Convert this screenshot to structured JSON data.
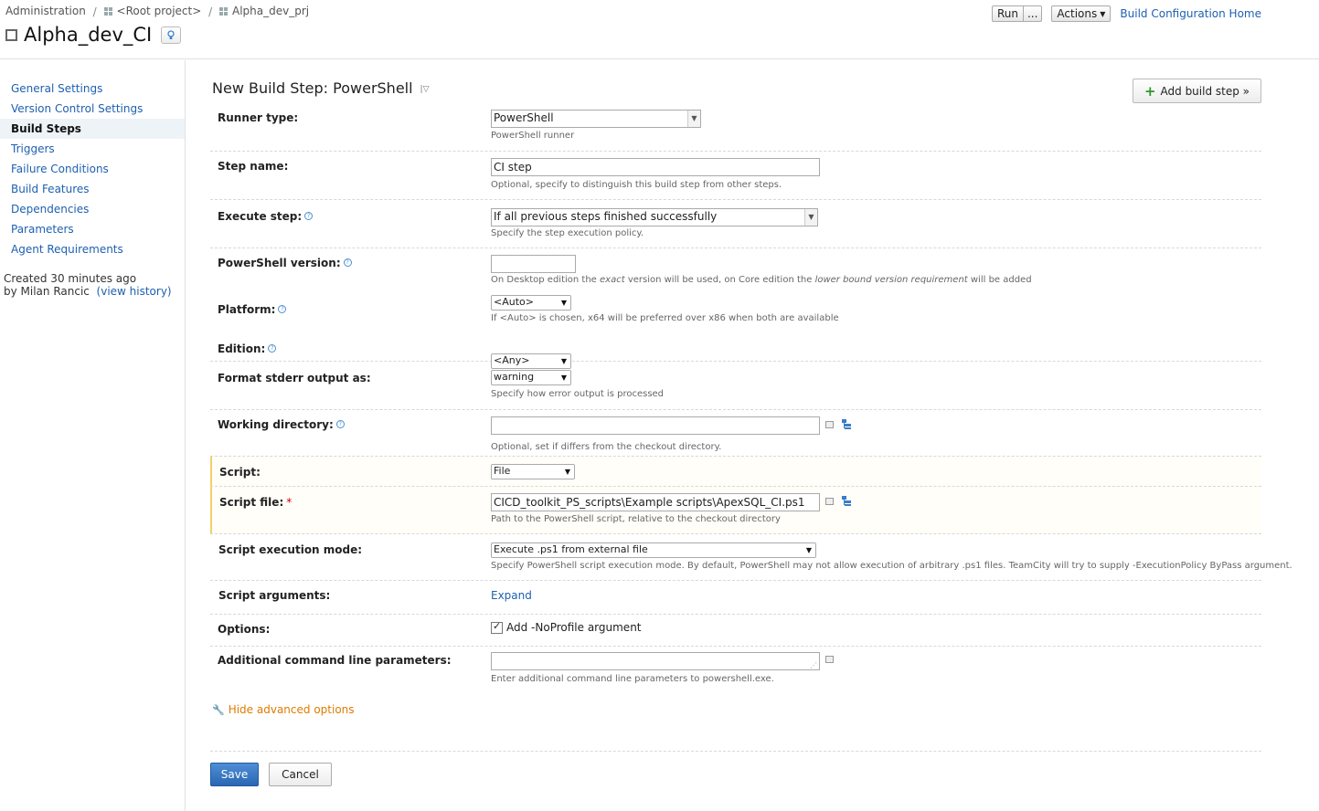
{
  "breadcrumb": {
    "admin": "Administration",
    "sep": "/",
    "root": "<Root project>",
    "project": "Alpha_dev_prj"
  },
  "title": "Alpha_dev_CI",
  "top_actions": {
    "run": "Run",
    "run_more": "...",
    "actions": "Actions",
    "home": "Build Configuration Home"
  },
  "sidebar": {
    "items": [
      {
        "label": "General Settings"
      },
      {
        "label": "Version Control Settings"
      },
      {
        "label": "Build Steps"
      },
      {
        "label": "Triggers"
      },
      {
        "label": "Failure Conditions"
      },
      {
        "label": "Build Features"
      },
      {
        "label": "Dependencies"
      },
      {
        "label": "Parameters"
      },
      {
        "label": "Agent Requirements"
      }
    ],
    "meta_created": "Created 30 minutes ago",
    "meta_by": "by Milan Rancic",
    "meta_history": "(view history)"
  },
  "step_title": "New Build Step: PowerShell",
  "add_step_label": "Add build step »",
  "form": {
    "runner_type": {
      "label": "Runner type:",
      "value": "PowerShell",
      "note": "PowerShell runner"
    },
    "step_name": {
      "label": "Step name:",
      "value": "CI step",
      "note": "Optional, specify to distinguish this build step from other steps."
    },
    "execute_step": {
      "label": "Execute step:",
      "value": "If all previous steps finished successfully",
      "note": "Specify the step execution policy."
    },
    "ps_version": {
      "label": "PowerShell version:",
      "value": "",
      "note_a": "On Desktop edition the ",
      "note_b": "exact",
      "note_c": " version will be used, on Core edition the ",
      "note_d": "lower bound version requirement",
      "note_e": " will be added"
    },
    "platform": {
      "label": "Platform:",
      "value": "<Auto>",
      "note": "If <Auto> is chosen, x64 will be preferred over x86 when both are available"
    },
    "edition": {
      "label": "Edition:",
      "value": "<Any>"
    },
    "stderr": {
      "label": "Format stderr output as:",
      "value": "warning",
      "note": "Specify how error output is processed"
    },
    "working_dir": {
      "label": "Working directory:",
      "value": "",
      "note": "Optional, set if differs from the checkout directory."
    },
    "script": {
      "label": "Script:",
      "value": "File"
    },
    "script_file": {
      "label": "Script file:",
      "required": "*",
      "value": "CICD_toolkit_PS_scripts\\Example scripts\\ApexSQL_CI.ps1",
      "note": "Path to the PowerShell script, relative to the checkout directory"
    },
    "exec_mode": {
      "label": "Script execution mode:",
      "value": "Execute .ps1 from external file",
      "note": "Specify PowerShell script execution mode. By default, PowerShell may not allow execution of arbitrary .ps1 files. TeamCity will try to supply -ExecutionPolicy ByPass argument."
    },
    "script_args": {
      "label": "Script arguments:",
      "link": "Expand"
    },
    "options": {
      "label": "Options:",
      "checkbox": "Add -NoProfile argument"
    },
    "additional": {
      "label": "Additional command line parameters:",
      "value": "",
      "note": "Enter additional command line parameters to powershell.exe."
    }
  },
  "advanced_link": "Hide advanced options",
  "buttons": {
    "save": "Save",
    "cancel": "Cancel"
  }
}
